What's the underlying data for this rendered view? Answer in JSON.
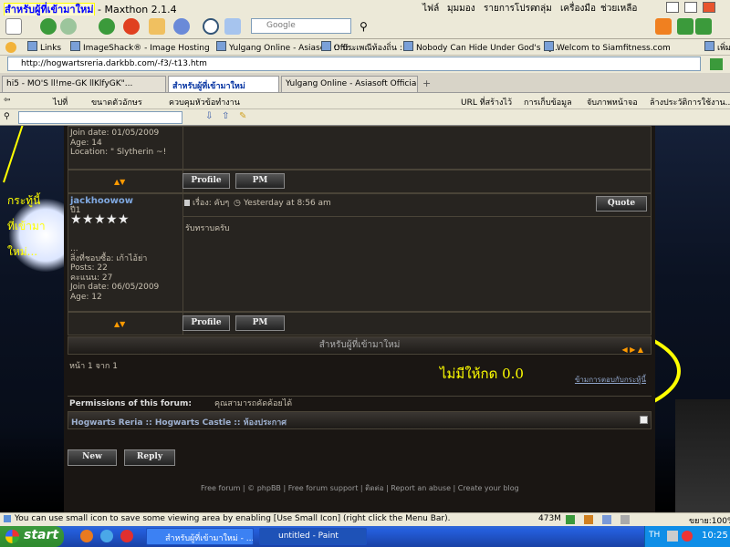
{
  "window": {
    "title_highlight": "สำหรับผู้ที่เข้ามาใหม่",
    "title_suffix": " - Maxthon 2.1.4",
    "menu": [
      "ไฟล์",
      "มุมมอง",
      "รายการโปรด",
      "กลุ่ม",
      "เครื่องมือ",
      "ช่วยเหลือ"
    ]
  },
  "toolbar": {
    "search_placeholder": "Google",
    "extra": "เพิ่ม"
  },
  "links_bar": {
    "label": "Links",
    "items": [
      "ImageShack® - Image Hosting",
      "Yulgang Online - Asiasoft Offi...",
      ":: ประเพณีท้องถิ่น ::",
      "Nobody Can Hide Under God's Ey...",
      "Welcom to Siamfitness.com"
    ]
  },
  "address": {
    "url": "http://hogwartsreria.darkbb.com/-f3/-t13.htm"
  },
  "tabs": [
    {
      "label": "hi5 - MO'S ll!me-GK llKlfyGK\"..."
    },
    {
      "label": "สำหรับผู้ที่เข้ามาใหม่"
    },
    {
      "label": "Yulgang Online - Asiasoft Official..."
    }
  ],
  "fav_bar": {
    "items": [
      "ไปที่",
      "ขนาดตัวอักษร",
      "ควบคุมหัวข้อทำงาน",
      "URL ที่สร้างไว้",
      "การเก็บข้อมูล",
      "จับภาพหน้าจอ",
      "ล้างประวัติการใช้งาน..."
    ]
  },
  "forum": {
    "post1": {
      "profile_lines": [
        "Join date: 01/05/2009",
        "Age: 14",
        "Location: \" Slytherin ~!"
      ]
    },
    "post2": {
      "username": "jackhoowow",
      "rank": "ปี1",
      "title_label": "เรื่อง: คับๆ",
      "time": "Yesterday at 8:56 am",
      "body": "รับทราบครับ",
      "profile_lines": [
        "...",
        "สิ่งที่ชอบซื้อ: เก้าไอ้ย่า",
        "Posts: 22",
        "คะแนน: 27",
        "Join date: 06/05/2009",
        "Age: 12"
      ]
    },
    "buttons": {
      "profile": "Profile",
      "pm": "PM",
      "quote": "Quote",
      "new": "New",
      "reply": "Reply"
    },
    "category_title": "สำหรับผู้ที่เข้ามาใหม่",
    "pagination": "หน้า 1 จาก 1",
    "jump_link": "ข้ามการตอบกับกระทู้นี้",
    "permissions_label": "Permissions of this forum:",
    "permissions_value": "คุณสามารถคัดค้อยได้",
    "breadcrumb": "Hogwarts Reria :: Hogwarts Castle :: ห้องประกาศ",
    "footer_links": [
      "Free forum",
      "© phpBB",
      "Free forum support",
      "ติดต่อ",
      "Report an abuse",
      "Create your blog"
    ]
  },
  "annotations": {
    "side_note_lines": [
      "กระทู้นี้",
      "ที่เข้ามา",
      "ใหม่..."
    ],
    "ellipse_text": "ไม่มีให้กด 0.0"
  },
  "statusbar": {
    "message": "You can use small icon to save some viewing area by enabling [Use Small Icon] (right click the Menu Bar).",
    "memory": "473M",
    "zoom": "ขยาย:100%"
  },
  "taskbar": {
    "start": "start",
    "items": [
      "สำหรับผู้ที่เข้ามาใหม่ - ...",
      "untitled - Paint"
    ],
    "lang": "TH",
    "clock": "10:25"
  },
  "colors": {
    "accent_yellow": "#ffff00",
    "link_blue": "#0030a0"
  }
}
